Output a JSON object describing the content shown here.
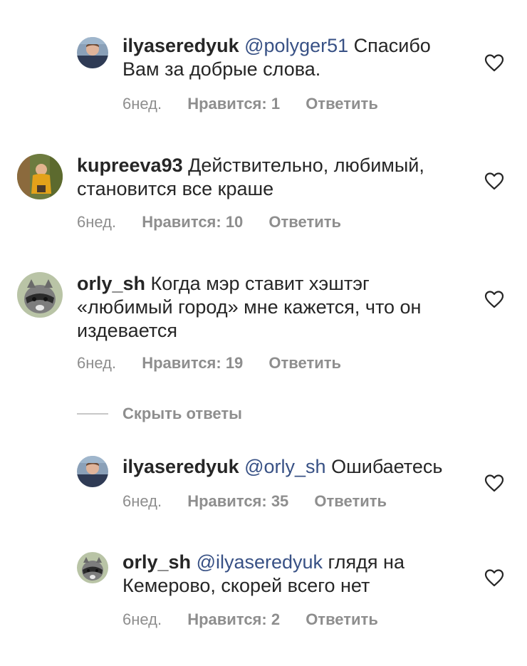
{
  "comments": [
    {
      "username": "ilyaseredyuk",
      "mention": "@polyger51",
      "text_lines": [
        " Спасибо",
        "Вам за добрые слова."
      ],
      "age": "6нед.",
      "likes": "Нравится: 1",
      "reply": "Ответить",
      "avatar": "avatar-ilyaseredyuk"
    },
    {
      "username": "kupreeva93",
      "mention": "",
      "text_lines": [
        " Действительно, любимый,",
        "становится все краше"
      ],
      "age": "6нед.",
      "likes": "Нравится: 10",
      "reply": "Ответить",
      "avatar": "avatar-kupreeva93"
    },
    {
      "username": "orly_sh",
      "mention": "",
      "text_lines": [
        " Когда мэр ставит хэштэг",
        "«любимый город» мне кажется, что он",
        "издевается"
      ],
      "age": "6нед.",
      "likes": "Нравится: 19",
      "reply": "Ответить",
      "avatar": "avatar-raccoon"
    },
    {
      "username": "ilyaseredyuk",
      "mention": "@orly_sh",
      "text_lines": [
        " Ошибаетесь"
      ],
      "age": "6нед.",
      "likes": "Нравится: 35",
      "reply": "Ответить",
      "avatar": "avatar-ilyaseredyuk"
    },
    {
      "username": "orly_sh",
      "mention": "@ilyaseredyuk",
      "text_lines": [
        " глядя на",
        "Кемерово, скорей всего нет"
      ],
      "age": "6нед.",
      "likes": "Нравится: 2",
      "reply": "Ответить",
      "avatar": "avatar-raccoon"
    }
  ],
  "hide_replies": "Скрыть ответы",
  "icons": {
    "like": "heart-outline-icon"
  },
  "colors": {
    "text": "#262626",
    "secondary": "#8e8e8e",
    "mention": "#385185"
  }
}
